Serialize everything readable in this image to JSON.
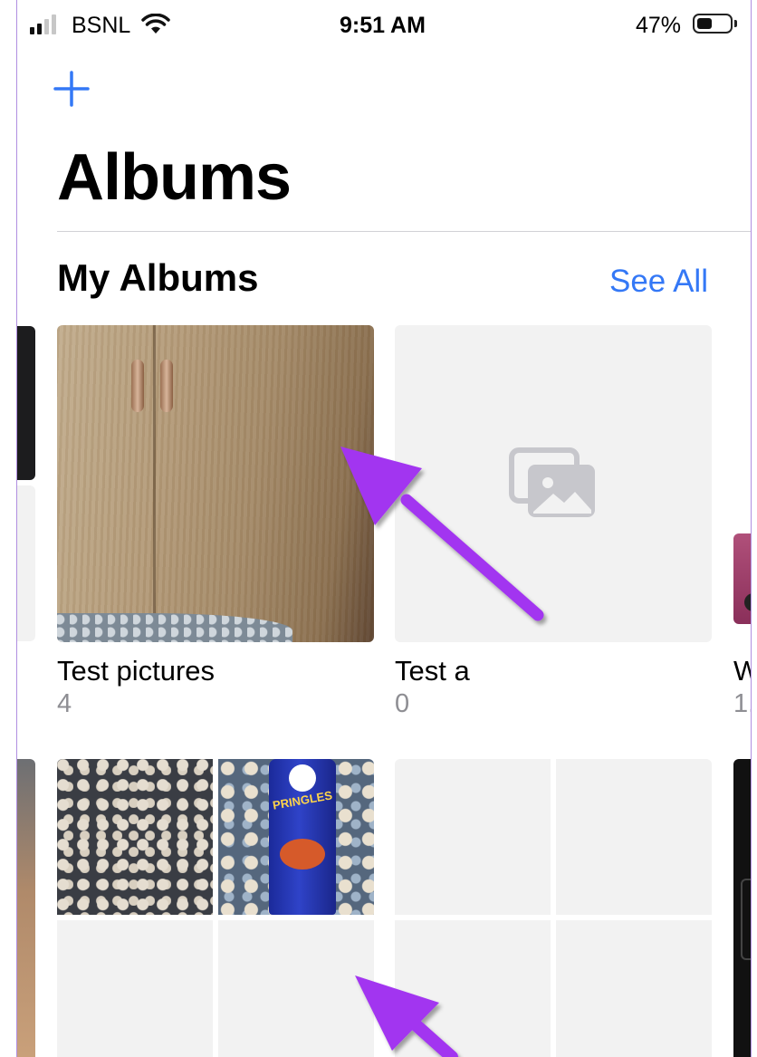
{
  "status_bar": {
    "carrier": "BSNL",
    "time": "9:51 AM",
    "battery_percent": "47%",
    "signal_bars_filled": 2,
    "signal_bars_total": 4,
    "battery_level": 0.47
  },
  "header": {
    "add_icon": "plus-icon",
    "title": "Albums"
  },
  "my_albums": {
    "title": "My Albums",
    "see_all_label": "See All",
    "albums": [
      {
        "name": "Test pictures",
        "count": "4"
      },
      {
        "name": "Test a",
        "count": "0"
      },
      {
        "name": "W",
        "count": "1,"
      }
    ]
  },
  "colors": {
    "accent": "#3478f6",
    "annotation_arrow": "#a236f0",
    "placeholder_bg": "#f2f2f2",
    "secondary_text": "#8e8e93"
  },
  "icons": {
    "empty_album": "photos-stack-icon",
    "wifi": "wifi-icon",
    "battery": "battery-icon",
    "signal": "signal-icon"
  }
}
